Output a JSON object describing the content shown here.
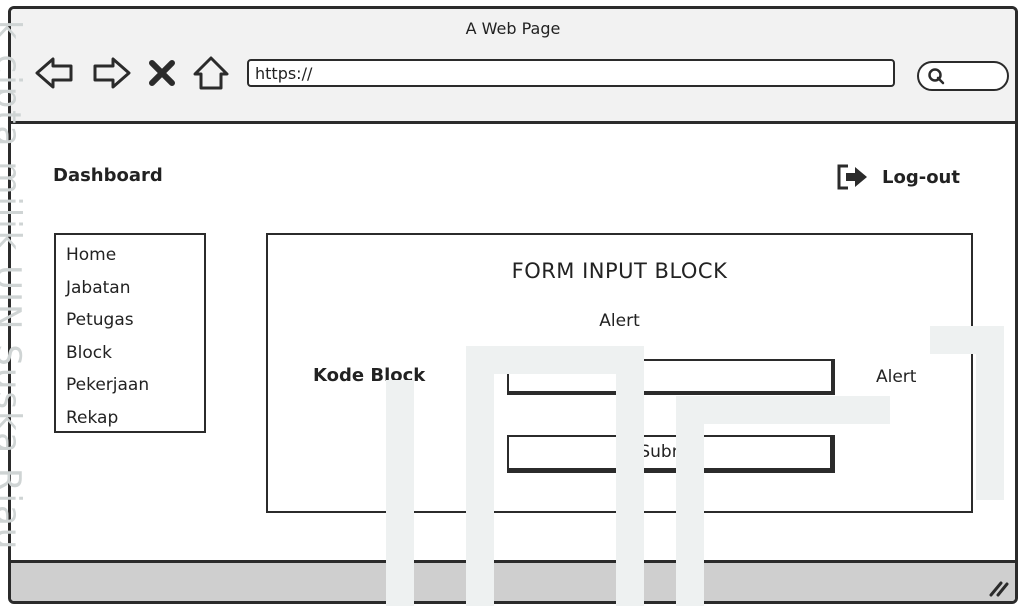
{
  "browser": {
    "title": "A Web Page",
    "url": "https://",
    "nav_icons": [
      "back-arrow-icon",
      "forward-arrow-icon",
      "close-icon",
      "home-icon"
    ],
    "search_icon": "search-icon"
  },
  "header": {
    "title": "Dashboard",
    "logout_label": "Log-out",
    "logout_icon": "logout-icon"
  },
  "sidebar": {
    "items": [
      {
        "label": "Home"
      },
      {
        "label": "Jabatan"
      },
      {
        "label": "Petugas"
      },
      {
        "label": "Block"
      },
      {
        "label": "Pekerjaan"
      },
      {
        "label": "Rekap"
      }
    ]
  },
  "form": {
    "title": "FORM INPUT BLOCK",
    "alert_top": "Alert",
    "field_label": "Kode Block",
    "field_value": "",
    "alert_right": "Alert",
    "submit_label": "Submit"
  },
  "watermark": {
    "text": "k cipta milik UIN Suska Riau"
  },
  "colors": {
    "border": "#2b2b2b",
    "titlebar": "#f2f2f2",
    "statusbar": "#cfcfcf",
    "watermark": "#cfd4d4"
  }
}
